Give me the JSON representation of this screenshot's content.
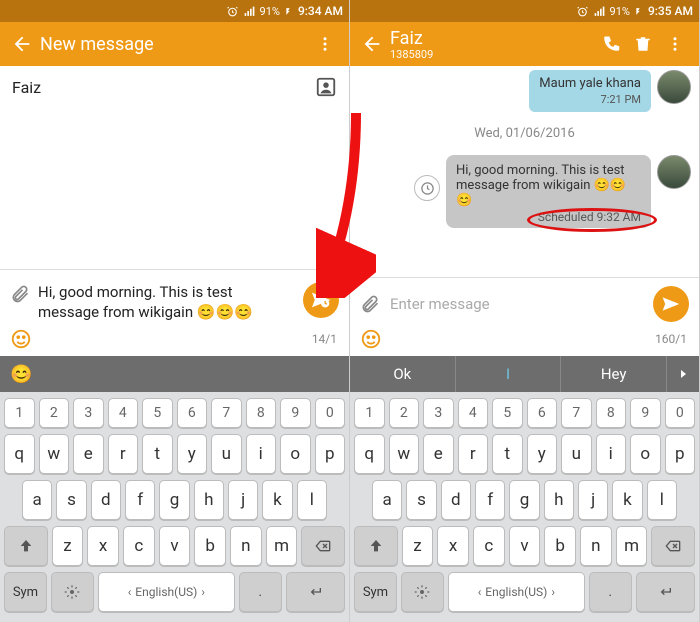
{
  "left": {
    "status": {
      "battery": "91%",
      "time": "9:34 AM"
    },
    "appbar": {
      "title": "New message"
    },
    "contact": {
      "value": "Faiz"
    },
    "compose": {
      "text": "Hi, good morning. This is test message from wikigain 😊😊😊",
      "counter": "14/1"
    },
    "suggest_emoji": "😊"
  },
  "right": {
    "status": {
      "battery": "91%",
      "time": "9:35 AM"
    },
    "appbar": {
      "title": "Faiz",
      "subtitle": "1385809"
    },
    "prev_msg": {
      "text": "Maum yale khana",
      "time": "7:21 PM"
    },
    "date_separator": "Wed, 01/06/2016",
    "sched_msg": {
      "text": "Hi, good morning. This is test message from wikigain 😊😊😊",
      "scheduled": "Scheduled 9:32 AM"
    },
    "compose": {
      "placeholder": "Enter message",
      "counter": "160/1"
    },
    "suggestions": [
      "Ok",
      "I",
      "Hey"
    ]
  },
  "keyboard": {
    "nums": [
      "1",
      "2",
      "3",
      "4",
      "5",
      "6",
      "7",
      "8",
      "9",
      "0"
    ],
    "r1": [
      "q",
      "w",
      "e",
      "r",
      "t",
      "y",
      "u",
      "i",
      "o",
      "p"
    ],
    "r2": [
      "a",
      "s",
      "d",
      "f",
      "g",
      "h",
      "j",
      "k",
      "l"
    ],
    "r3": [
      "z",
      "x",
      "c",
      "v",
      "b",
      "n",
      "m"
    ],
    "sym": "Sym",
    "lang": "English(US)"
  }
}
